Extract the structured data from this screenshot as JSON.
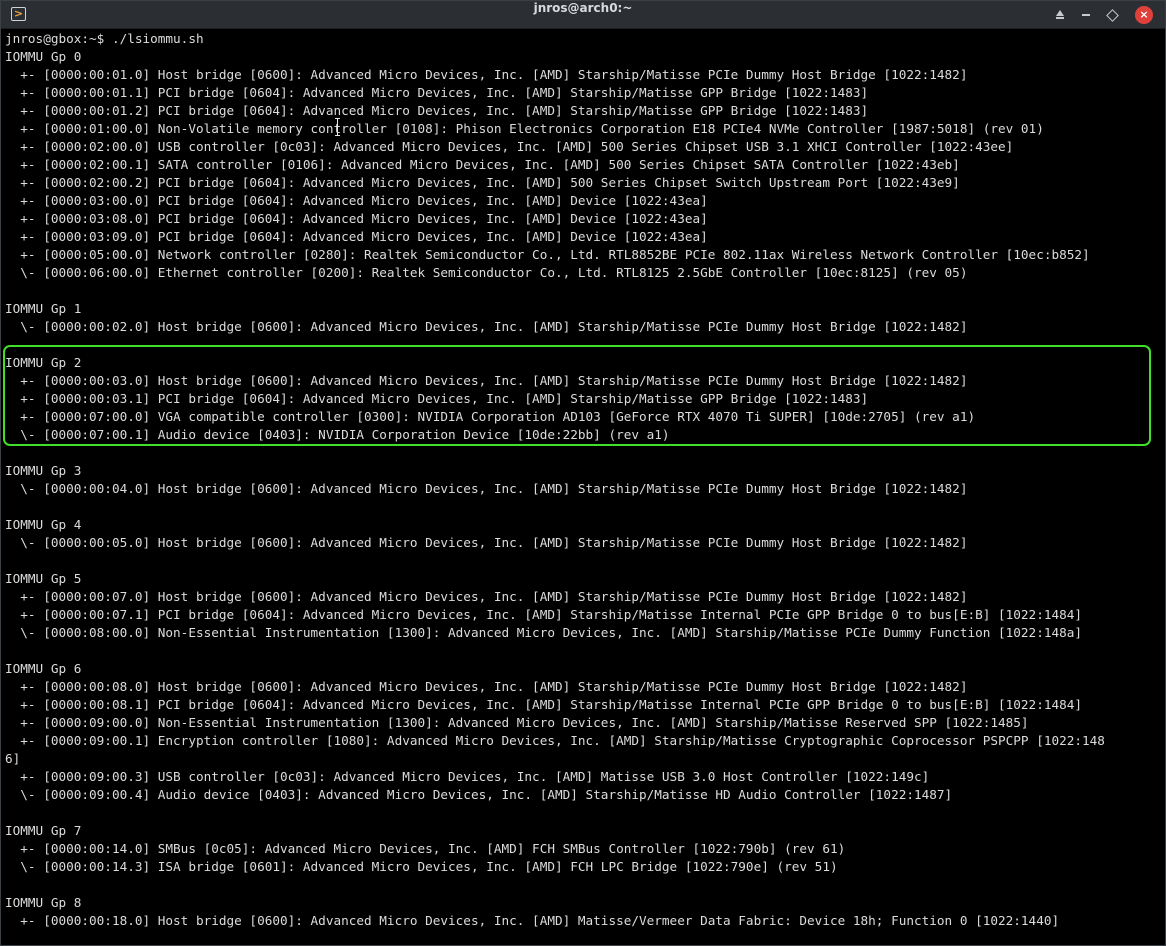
{
  "window": {
    "title": "jnros@arch0:~",
    "app_icon": "konsole-icon",
    "controls": [
      "keep-above-icon",
      "minimize-icon",
      "maximize-icon",
      "close-icon"
    ],
    "close_color": "#e0403a"
  },
  "terminal": {
    "highlight_color": "#40e02a",
    "lines": [
      "jnros@gbox:~$ ./lsiommu.sh",
      "IOMMU Gp 0",
      "  +- [0000:00:01.0] Host bridge [0600]: Advanced Micro Devices, Inc. [AMD] Starship/Matisse PCIe Dummy Host Bridge [1022:1482]",
      "  +- [0000:00:01.1] PCI bridge [0604]: Advanced Micro Devices, Inc. [AMD] Starship/Matisse GPP Bridge [1022:1483]",
      "  +- [0000:00:01.2] PCI bridge [0604]: Advanced Micro Devices, Inc. [AMD] Starship/Matisse GPP Bridge [1022:1483]",
      "  +- [0000:01:00.0] Non-Volatile memory controller [0108]: Phison Electronics Corporation E18 PCIe4 NVMe Controller [1987:5018] (rev 01)",
      "  +- [0000:02:00.0] USB controller [0c03]: Advanced Micro Devices, Inc. [AMD] 500 Series Chipset USB 3.1 XHCI Controller [1022:43ee]",
      "  +- [0000:02:00.1] SATA controller [0106]: Advanced Micro Devices, Inc. [AMD] 500 Series Chipset SATA Controller [1022:43eb]",
      "  +- [0000:02:00.2] PCI bridge [0604]: Advanced Micro Devices, Inc. [AMD] 500 Series Chipset Switch Upstream Port [1022:43e9]",
      "  +- [0000:03:00.0] PCI bridge [0604]: Advanced Micro Devices, Inc. [AMD] Device [1022:43ea]",
      "  +- [0000:03:08.0] PCI bridge [0604]: Advanced Micro Devices, Inc. [AMD] Device [1022:43ea]",
      "  +- [0000:03:09.0] PCI bridge [0604]: Advanced Micro Devices, Inc. [AMD] Device [1022:43ea]",
      "  +- [0000:05:00.0] Network controller [0280]: Realtek Semiconductor Co., Ltd. RTL8852BE PCIe 802.11ax Wireless Network Controller [10ec:b852]",
      "  \\- [0000:06:00.0] Ethernet controller [0200]: Realtek Semiconductor Co., Ltd. RTL8125 2.5GbE Controller [10ec:8125] (rev 05)",
      "",
      "IOMMU Gp 1",
      "  \\- [0000:00:02.0] Host bridge [0600]: Advanced Micro Devices, Inc. [AMD] Starship/Matisse PCIe Dummy Host Bridge [1022:1482]",
      "",
      "IOMMU Gp 2",
      "  +- [0000:00:03.0] Host bridge [0600]: Advanced Micro Devices, Inc. [AMD] Starship/Matisse PCIe Dummy Host Bridge [1022:1482]",
      "  +- [0000:00:03.1] PCI bridge [0604]: Advanced Micro Devices, Inc. [AMD] Starship/Matisse GPP Bridge [1022:1483]",
      "  +- [0000:07:00.0] VGA compatible controller [0300]: NVIDIA Corporation AD103 [GeForce RTX 4070 Ti SUPER] [10de:2705] (rev a1)",
      "  \\- [0000:07:00.1] Audio device [0403]: NVIDIA Corporation Device [10de:22bb] (rev a1)",
      "",
      "IOMMU Gp 3",
      "  \\- [0000:00:04.0] Host bridge [0600]: Advanced Micro Devices, Inc. [AMD] Starship/Matisse PCIe Dummy Host Bridge [1022:1482]",
      "",
      "IOMMU Gp 4",
      "  \\- [0000:00:05.0] Host bridge [0600]: Advanced Micro Devices, Inc. [AMD] Starship/Matisse PCIe Dummy Host Bridge [1022:1482]",
      "",
      "IOMMU Gp 5",
      "  +- [0000:00:07.0] Host bridge [0600]: Advanced Micro Devices, Inc. [AMD] Starship/Matisse PCIe Dummy Host Bridge [1022:1482]",
      "  +- [0000:00:07.1] PCI bridge [0604]: Advanced Micro Devices, Inc. [AMD] Starship/Matisse Internal PCIe GPP Bridge 0 to bus[E:B] [1022:1484]",
      "  \\- [0000:08:00.0] Non-Essential Instrumentation [1300]: Advanced Micro Devices, Inc. [AMD] Starship/Matisse PCIe Dummy Function [1022:148a]",
      "",
      "IOMMU Gp 6",
      "  +- [0000:00:08.0] Host bridge [0600]: Advanced Micro Devices, Inc. [AMD] Starship/Matisse PCIe Dummy Host Bridge [1022:1482]",
      "  +- [0000:00:08.1] PCI bridge [0604]: Advanced Micro Devices, Inc. [AMD] Starship/Matisse Internal PCIe GPP Bridge 0 to bus[E:B] [1022:1484]",
      "  +- [0000:09:00.0] Non-Essential Instrumentation [1300]: Advanced Micro Devices, Inc. [AMD] Starship/Matisse Reserved SPP [1022:1485]",
      "  +- [0000:09:00.1] Encryption controller [1080]: Advanced Micro Devices, Inc. [AMD] Starship/Matisse Cryptographic Coprocessor PSPCPP [1022:148",
      "6]",
      "  +- [0000:09:00.3] USB controller [0c03]: Advanced Micro Devices, Inc. [AMD] Matisse USB 3.0 Host Controller [1022:149c]",
      "  \\- [0000:09:00.4] Audio device [0403]: Advanced Micro Devices, Inc. [AMD] Starship/Matisse HD Audio Controller [1022:1487]",
      "",
      "IOMMU Gp 7",
      "  +- [0000:00:14.0] SMBus [0c05]: Advanced Micro Devices, Inc. [AMD] FCH SMBus Controller [1022:790b] (rev 61)",
      "  \\- [0000:00:14.3] ISA bridge [0601]: Advanced Micro Devices, Inc. [AMD] FCH LPC Bridge [1022:790e] (rev 51)",
      "",
      "IOMMU Gp 8",
      "  +- [0000:00:18.0] Host bridge [0600]: Advanced Micro Devices, Inc. [AMD] Matisse/Vermeer Data Fabric: Device 18h; Function 0 [1022:1440]"
    ]
  }
}
